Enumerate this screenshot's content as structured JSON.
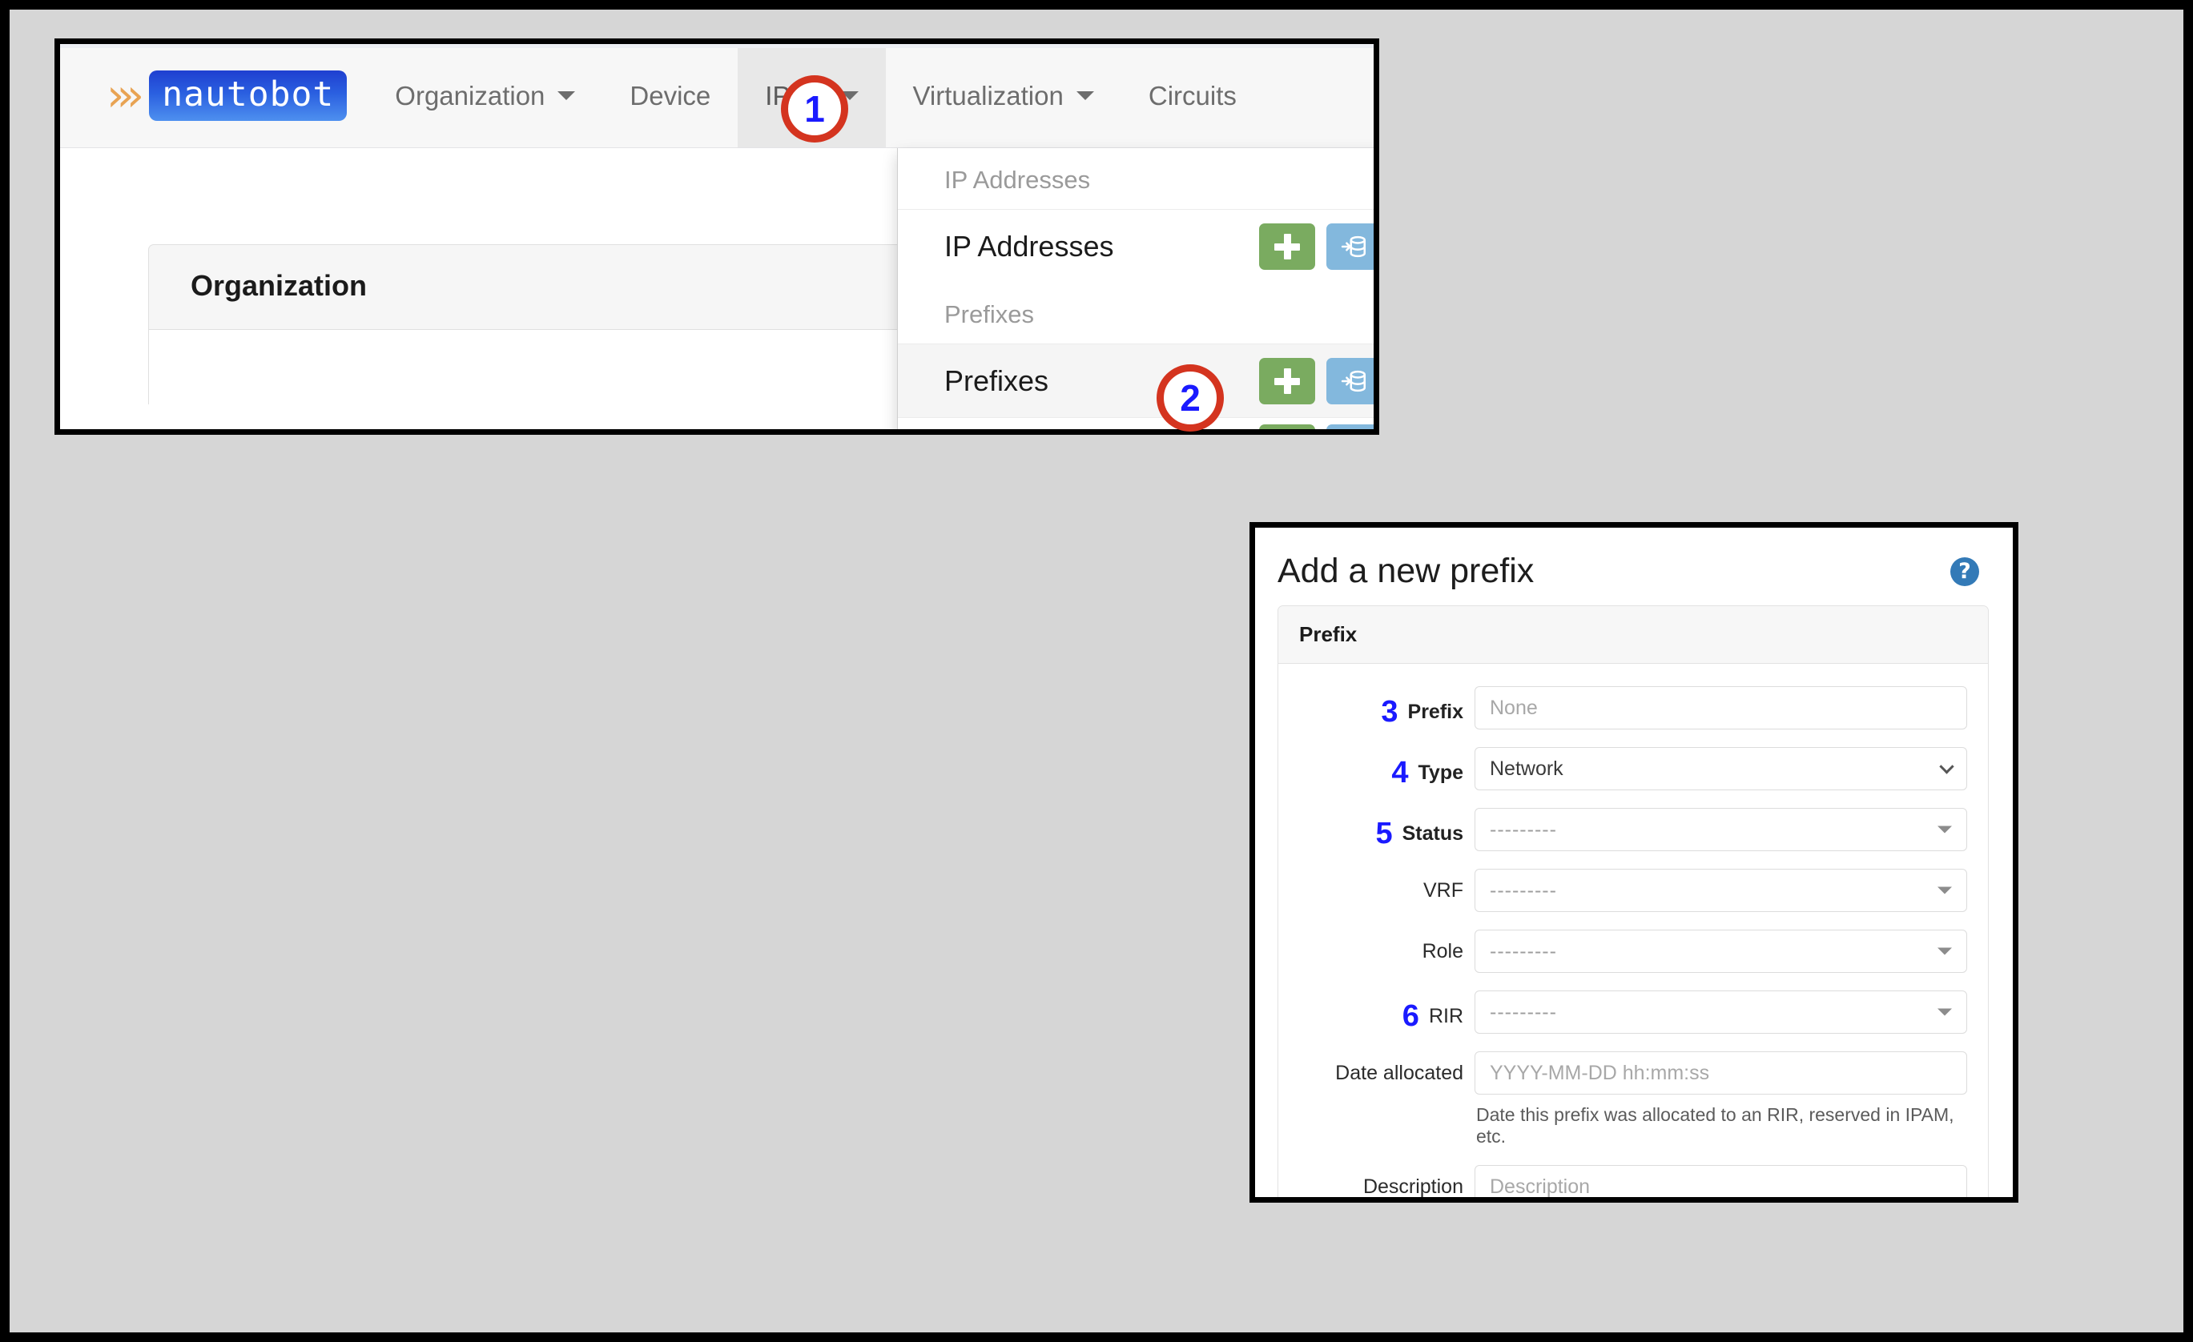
{
  "navbar": {
    "brand": {
      "chevrons": "›››",
      "name": "nautobot"
    },
    "items": [
      {
        "label": "Organization",
        "has_caret": true,
        "active": false
      },
      {
        "label": "Device",
        "has_caret": false,
        "active": false
      },
      {
        "label": "IPAM",
        "has_caret": true,
        "active": true
      },
      {
        "label": "Virtualization",
        "has_caret": true,
        "active": false
      },
      {
        "label": "Circuits",
        "has_caret": false,
        "active": false
      }
    ]
  },
  "dropdown": {
    "groups": [
      {
        "header": "IP Addresses",
        "item_label": "IP Addresses",
        "add_icon": "plus-icon",
        "import_icon": "database-import-icon",
        "hover": false
      },
      {
        "header": "Prefixes",
        "item_label": "Prefixes",
        "add_icon": "plus-icon",
        "import_icon": "database-import-icon",
        "hover": true
      }
    ]
  },
  "page_card": {
    "title": "Organization"
  },
  "form": {
    "title": "Add a new prefix",
    "help_icon": "question-circle-icon",
    "section_title": "Prefix",
    "fields": [
      {
        "step": "3",
        "label": "Prefix",
        "type": "text",
        "value": "",
        "placeholder": "None",
        "bold_label": true
      },
      {
        "step": "4",
        "label": "Type",
        "type": "select",
        "value": "Network",
        "placeholder": "",
        "bold_label": true
      },
      {
        "step": "5",
        "label": "Status",
        "type": "select2",
        "value": "",
        "placeholder": "---------",
        "bold_label": true
      },
      {
        "step": "",
        "label": "VRF",
        "type": "select2",
        "value": "",
        "placeholder": "---------",
        "bold_label": false
      },
      {
        "step": "",
        "label": "Role",
        "type": "select2",
        "value": "",
        "placeholder": "---------",
        "bold_label": false
      },
      {
        "step": "6",
        "label": "RIR",
        "type": "select2",
        "value": "",
        "placeholder": "---------",
        "bold_label": false
      },
      {
        "step": "",
        "label": "Date allocated",
        "type": "text",
        "value": "",
        "placeholder": "YYYY-MM-DD hh:mm:ss",
        "bold_label": false,
        "help_text": "Date this prefix was allocated to an RIR, reserved in IPAM, etc."
      },
      {
        "step": "",
        "label": "Description",
        "type": "text",
        "value": "",
        "placeholder": "Description",
        "bold_label": false
      }
    ]
  },
  "annotations": [
    {
      "number": "1",
      "target": "IPAM nav item"
    },
    {
      "number": "2",
      "target": "Prefixes add button"
    }
  ],
  "colors": {
    "brand_blue": "#2a5fe0",
    "brand_orange": "#e8a353",
    "add_green": "#7aab60",
    "import_blue": "#83b8dd",
    "marker_red": "#d4341f",
    "marker_number_blue": "#1a1aff",
    "help_blue": "#337ab7"
  }
}
